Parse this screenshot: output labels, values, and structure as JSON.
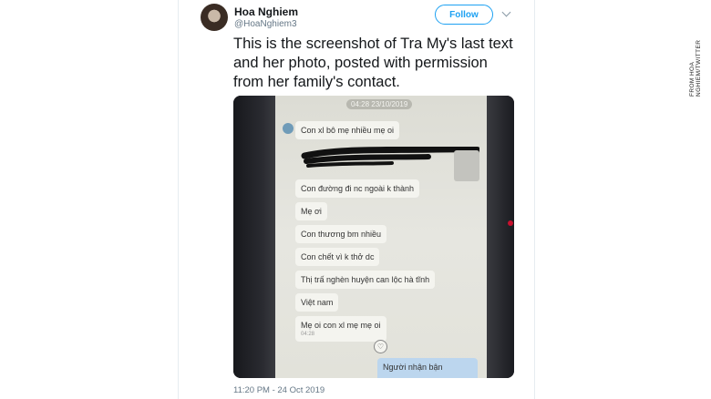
{
  "tweet": {
    "display_name": "Hoa Nghiem",
    "handle": "@HoaNghiem3",
    "follow_label": "Follow",
    "text": "This is the screenshot of Tra My's last text and her photo, posted with permission from her family's contact.",
    "timestamp": "11:20 PM - 24 Oct 2019"
  },
  "phone_screenshot": {
    "date_stamp": "04:28 23/10/2019",
    "messages": [
      "Con xl bô mẹ nhiều mẹ oi",
      "Con đường đi nc ngoài k thành",
      "Mẹ ơi",
      "Con thương bm nhiều",
      "Con chết vì k thở dc",
      "Thị trấ nghèn huyện can lộc hà tĩnh",
      "Việt nam",
      "Mẹ oi con xl mẹ mẹ oi"
    ],
    "last_message_time": "04:28",
    "reply_preview": "Người nhận bận"
  },
  "credit": "FROM HOA NGHIEM/TWITTER",
  "colors": {
    "accent": "#1da1f2",
    "text": "#14171a",
    "muted": "#657786"
  },
  "icons": {
    "heart": "heart-icon",
    "caret": "chevron-down-icon"
  }
}
